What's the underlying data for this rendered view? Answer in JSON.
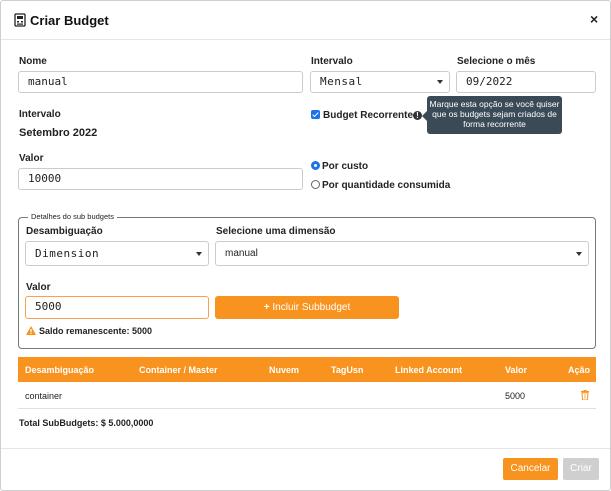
{
  "dialog": {
    "title": "Criar Budget",
    "close_label": "×"
  },
  "form": {
    "name_label": "Nome",
    "name_value": "manual",
    "interval_label": "Intervalo",
    "interval_value": "Mensal",
    "month_label": "Selecione o mês",
    "month_value": "09/2022",
    "interval_summary_label": "Intervalo",
    "interval_summary_value": "Setembro 2022",
    "recurring_label": "Budget Recorrente",
    "recurring_checked": true,
    "tooltip_text": "Marque esta opção se você quiser que os budgets sejam criados de forma recorrente",
    "value_label": "Valor",
    "value_value": "10000",
    "radio_cost_label": "Por custo",
    "radio_quantity_label": "Por quantidade consumida",
    "radio_selected": "cost"
  },
  "sub_budgets": {
    "legend": "Detalhes do sub budgets",
    "disambiguation_label": "Desambiguação",
    "disambiguation_value": "Dimension",
    "dimension_label": "Selecione uma dimensão",
    "dimension_value": "manual",
    "value_label": "Valor",
    "value_value": "5000",
    "add_button_label": "Incluir Subbudget",
    "remaining_text": "Saldo remanescente: 5000"
  },
  "table": {
    "headers": [
      "Desambiguação",
      "Container / Master",
      "Nuvem",
      "TagUsn",
      "Linked Account",
      "Valor",
      "Ação"
    ],
    "rows": [
      {
        "disambiguation": "container",
        "container": "",
        "cloud": "",
        "tag": "",
        "linked_account": "",
        "value": "5000"
      }
    ]
  },
  "total_label": "Total SubBudgets: $ 5.000,0000",
  "footer": {
    "cancel_label": "Cancelar",
    "create_label": "Criar"
  },
  "colors": {
    "accent": "#f7931e",
    "tooltip_bg": "#3b4a57",
    "checkbox": "#1a73e8",
    "disabled": "#cfcfcf"
  },
  "icons": {
    "title": "budget-document-icon",
    "info": "info-icon",
    "warning": "warning-icon",
    "delete": "trash-icon",
    "add": "plus-icon"
  }
}
